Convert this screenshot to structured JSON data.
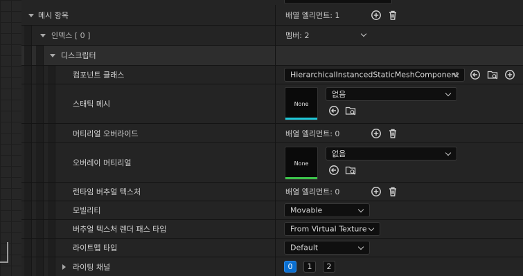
{
  "rows": {
    "mesh_items": {
      "label": "메시 항목",
      "value": "배열 엘리먼트: 1"
    },
    "index0": {
      "label": "인덱스 [ 0 ]",
      "value": "멤버: 2"
    },
    "descriptor": {
      "label": "디스크립터"
    },
    "component_class": {
      "label": "컴포넌트 클래스",
      "value": "HierarchicalInstancedStaticMeshComponent"
    },
    "static_mesh": {
      "label": "스태틱 메시",
      "thumb": "None",
      "value": "없음",
      "thumb_accent": "#1fc8d8"
    },
    "material_overrides": {
      "label": "머티리얼 오버라이드",
      "value": "배열 엘리먼트: 0"
    },
    "overlay_material": {
      "label": "오버레이 머티리얼",
      "thumb": "None",
      "value": "없음",
      "thumb_accent": "#3cc24a"
    },
    "runtime_vt": {
      "label": "런타임 버추얼 텍스처",
      "value": "배열 엘리먼트: 0"
    },
    "mobility": {
      "label": "모빌리티",
      "value": "Movable"
    },
    "vt_render_pass": {
      "label": "버추얼 텍스처 렌더 패스 타입",
      "value": "From Virtual Texture"
    },
    "lightmap_type": {
      "label": "라이트맵 타입",
      "value": "Default"
    },
    "lighting_channels": {
      "label": "라이팅 채널",
      "options": [
        "0",
        "1",
        "2"
      ],
      "selected": "0"
    }
  },
  "colors": {
    "accent_blue": "#0a6fd0"
  }
}
